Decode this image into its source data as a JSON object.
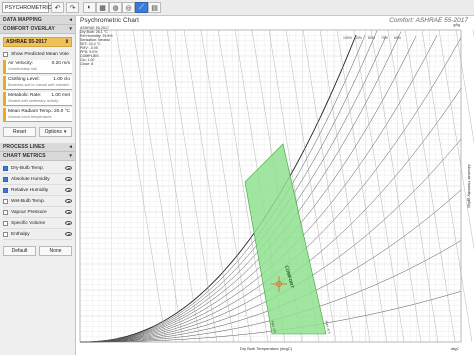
{
  "toolbar": {
    "app_name": "PSYCHROMETRIC",
    "undo": "↶",
    "redo": "↷"
  },
  "sidebar": {
    "data_mapping": "DATA MAPPING",
    "comfort_overlay": "COMFORT OVERLAY",
    "standard": "ASHRAE 55-2017",
    "show_pmv": "Show Predicted Mean Vote",
    "params": [
      {
        "title": "Air Velocity:",
        "value": "0.20 m/s",
        "desc": "Unnoticeably still."
      },
      {
        "title": "Clothing Level:",
        "value": "1.00 clo",
        "desc": "Business suit or casual with sweater."
      },
      {
        "title": "Metabolic Rate:",
        "value": "1.00 met",
        "desc": "Seated with sedentary activity."
      },
      {
        "title": "Mean Radiant Temp.:",
        "value": "20.0 °C",
        "desc": "Normal room temperature."
      }
    ],
    "reset": "Reset",
    "options": "Options",
    "process_lines": "PROCESS LINES",
    "chart_metrics": "CHART METRICS",
    "metrics": [
      {
        "label": "Dry-Bulb Temp.",
        "on": true
      },
      {
        "label": "Absolute Humidity",
        "on": true
      },
      {
        "label": "Relative Humidity",
        "on": true
      },
      {
        "label": "Wet-Bulb Temp.",
        "on": false
      },
      {
        "label": "Vapour Pressure",
        "on": false
      },
      {
        "label": "Specific Volume",
        "on": false
      },
      {
        "label": "Enthalpy",
        "on": false
      }
    ],
    "default": "Default",
    "none": "None"
  },
  "chart": {
    "title": "Psychrometric Chart",
    "subtitle": "Comfort: ASHRAE 55-2017",
    "info": [
      "ASHRAE 55-2017",
      "Dry Bulb: 26.1 °C",
      "Rel Humidity: 29.8%",
      "Sensation: Neutral",
      "SET: 24.4 °C",
      "PMV: -0.05",
      "PPD: 5.0%",
      "COMPLIES",
      "Clo: 1.00",
      "Close: 8"
    ],
    "comfort_label": "COMFORT",
    "pmv_left": "PMV -0.5",
    "pmv_right": "PMV +0.5",
    "xlabel": "Dry Bulb Temperature (degC)",
    "ylabel": "Absolute Humidity (g/kg)",
    "rh_labels": [
      "100%",
      "90%",
      "80%",
      "70%",
      "60%"
    ],
    "y_unit": "g/kg",
    "x_unit": "degC",
    "colors": {
      "comfort": "#8fe28f",
      "comfort_edge": "#3aa33a",
      "marker": "#e05a1e"
    }
  }
}
